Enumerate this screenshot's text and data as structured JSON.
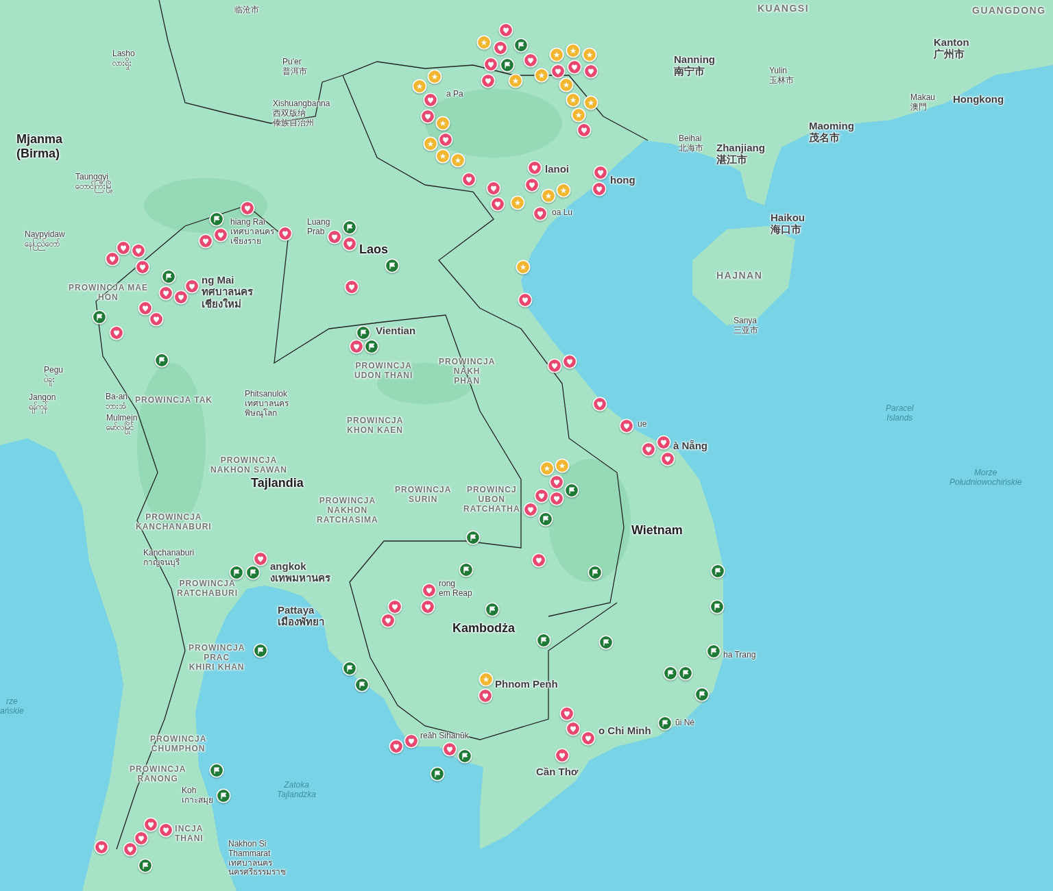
{
  "map": {
    "labels": [
      {
        "kind": "country",
        "lines": [
          "Mjanma",
          "(Birma)"
        ]
      },
      {
        "kind": "city",
        "lines": [
          "临沧市"
        ]
      },
      {
        "kind": "city",
        "lines": [
          "Lasho",
          "လားရှိုး"
        ]
      },
      {
        "kind": "city",
        "lines": [
          "Pu'er",
          "普洱市"
        ]
      },
      {
        "kind": "city",
        "lines": [
          "Xishuangbanna",
          "西双版纳",
          "傣族自治州"
        ]
      },
      {
        "kind": "city",
        "lines": [
          "Taunggyi",
          "တောင်ကြီးမြို့"
        ]
      },
      {
        "kind": "city",
        "lines": [
          "Naypyidaw",
          "နေပြည်တော်"
        ]
      },
      {
        "kind": "city",
        "lines": [
          "hiang Rai",
          "เทศบาลนคร",
          "เชียงราย"
        ]
      },
      {
        "kind": "city",
        "lines": [
          "Luang",
          "Prab"
        ]
      },
      {
        "kind": "country",
        "lines": [
          "Laos"
        ]
      },
      {
        "kind": "province",
        "lines": [
          "PROWINCJA MAE",
          "HON"
        ]
      },
      {
        "kind": "bigcity",
        "lines": [
          "ng Mai",
          "ทศบาลนคร",
          "เชียงใหม่"
        ]
      },
      {
        "kind": "bigcity",
        "lines": [
          "Vientian"
        ]
      },
      {
        "kind": "city",
        "lines": [
          "Pegu",
          "ပဲခူး"
        ]
      },
      {
        "kind": "province",
        "lines": [
          "PROWINCJA",
          "UDON THANI"
        ]
      },
      {
        "kind": "province",
        "lines": [
          "PROWINCJA",
          "NAKH",
          "PHAN"
        ]
      },
      {
        "kind": "city",
        "lines": [
          "Jangon",
          "ရန်ကုန်"
        ]
      },
      {
        "kind": "city",
        "lines": [
          "Ba-an",
          "ဘားအံ"
        ]
      },
      {
        "kind": "province",
        "lines": [
          "PROWINCJA TAK"
        ]
      },
      {
        "kind": "city",
        "lines": [
          "Phitsanulok",
          "เทศบาลนคร",
          "พิษณุโลก"
        ]
      },
      {
        "kind": "city",
        "lines": [
          "Mulmejn",
          "မော်လမြိုင်"
        ]
      },
      {
        "kind": "province",
        "lines": [
          "PROWINCJA",
          "KHON KAEN"
        ]
      },
      {
        "kind": "province",
        "lines": [
          "PROWINCJA",
          "NAKHON SAWAN"
        ]
      },
      {
        "kind": "country",
        "lines": [
          "Tajlandia"
        ]
      },
      {
        "kind": "province",
        "lines": [
          "PROWINCJA",
          "SURIN"
        ]
      },
      {
        "kind": "province",
        "lines": [
          "PROWINCJ",
          "UBON",
          "RATCHATHA"
        ]
      },
      {
        "kind": "province",
        "lines": [
          "PROWINCJA",
          "NAKHON",
          "RATCHASIMA"
        ]
      },
      {
        "kind": "province",
        "lines": [
          "PROWINCJA",
          "KANCHANABURI"
        ]
      },
      {
        "kind": "country",
        "lines": [
          "Wietnam"
        ]
      },
      {
        "kind": "city",
        "lines": [
          "Kanchanaburi",
          "กาญจนบุรี"
        ]
      },
      {
        "kind": "bigcity",
        "lines": [
          "angkok",
          "งเทพมหานคร"
        ]
      },
      {
        "kind": "province",
        "lines": [
          "PROWINCJA",
          "RATCHABURI"
        ]
      },
      {
        "kind": "city",
        "lines": [
          "rong",
          "em Reap"
        ]
      },
      {
        "kind": "bigcity",
        "lines": [
          "Pattaya",
          "เมืองพัทยา"
        ]
      },
      {
        "kind": "country",
        "lines": [
          "Kambodża"
        ]
      },
      {
        "kind": "province",
        "lines": [
          "PROWINCJA",
          "PRAC",
          "KHIRI KHAN"
        ]
      },
      {
        "kind": "city",
        "lines": [
          "ha Trang"
        ]
      },
      {
        "kind": "bigcity",
        "lines": [
          "Phnom Penh"
        ]
      },
      {
        "kind": "water",
        "lines": [
          "rze",
          "ańskie"
        ]
      },
      {
        "kind": "city",
        "lines": [
          "ũi Né"
        ]
      },
      {
        "kind": "bigcity",
        "lines": [
          "o Chi Minh"
        ]
      },
      {
        "kind": "city",
        "lines": [
          "reăh Sihanŭk"
        ]
      },
      {
        "kind": "province",
        "lines": [
          "PROWINCJA",
          "CHUMPHON"
        ]
      },
      {
        "kind": "province",
        "lines": [
          "PROWINCJA",
          "RANONG"
        ]
      },
      {
        "kind": "bigcity",
        "lines": [
          "Cần Thơ"
        ]
      },
      {
        "kind": "water",
        "lines": [
          "Zatoka",
          "Tajlandzka"
        ]
      },
      {
        "kind": "city",
        "lines": [
          "Koh",
          "เกาะสมุย"
        ]
      },
      {
        "kind": "province",
        "lines": [
          "INCJA",
          "THANI"
        ]
      },
      {
        "kind": "city",
        "lines": [
          "Nakhon Si",
          "Thammarat",
          "เทศบาลนคร",
          "นครศรีธรรมราช"
        ]
      },
      {
        "kind": "region",
        "lines": [
          "KUANGSI"
        ]
      },
      {
        "kind": "region",
        "lines": [
          "GUANGDONG"
        ]
      },
      {
        "kind": "bigcity",
        "lines": [
          "Kanton",
          "广州市"
        ]
      },
      {
        "kind": "bigcity",
        "lines": [
          "Nanning",
          "南宁市"
        ]
      },
      {
        "kind": "city",
        "lines": [
          "Yulin",
          "玉林市"
        ]
      },
      {
        "kind": "city",
        "lines": [
          "Makau",
          "澳門"
        ]
      },
      {
        "kind": "bigcity",
        "lines": [
          "Hongkong"
        ]
      },
      {
        "kind": "city",
        "lines": [
          "a Pa"
        ]
      },
      {
        "kind": "bigcity",
        "lines": [
          "Maoming",
          "茂名市"
        ]
      },
      {
        "kind": "city",
        "lines": [
          "Beihai",
          "北海市"
        ]
      },
      {
        "kind": "bigcity",
        "lines": [
          "Zhanjiang",
          "湛江市"
        ]
      },
      {
        "kind": "bigcity",
        "lines": [
          "lanoi"
        ]
      },
      {
        "kind": "bigcity",
        "lines": [
          "hong"
        ]
      },
      {
        "kind": "city",
        "lines": [
          "oa Lu"
        ]
      },
      {
        "kind": "bigcity",
        "lines": [
          "Haikou",
          "海口市"
        ]
      },
      {
        "kind": "region",
        "lines": [
          "HAJNAN"
        ]
      },
      {
        "kind": "city",
        "lines": [
          "Sanya",
          "三亚市"
        ]
      },
      {
        "kind": "water",
        "lines": [
          "Paracel",
          "Islands"
        ]
      },
      {
        "kind": "city",
        "lines": [
          "ue"
        ]
      },
      {
        "kind": "bigcity",
        "lines": [
          "à Nẵng"
        ]
      },
      {
        "kind": "water",
        "lines": [
          "Morze",
          "Południowochińskie"
        ]
      }
    ],
    "pins": [
      {
        "kind": "star"
      },
      {
        "kind": "heart"
      },
      {
        "kind": "flag"
      },
      {
        "kind": "heart"
      },
      {
        "kind": "heart"
      },
      {
        "kind": "heart"
      },
      {
        "kind": "flag"
      },
      {
        "kind": "star"
      },
      {
        "kind": "heart"
      },
      {
        "kind": "star"
      },
      {
        "kind": "star"
      },
      {
        "kind": "star"
      },
      {
        "kind": "star"
      },
      {
        "kind": "heart"
      },
      {
        "kind": "heart"
      },
      {
        "kind": "star"
      },
      {
        "kind": "heart"
      },
      {
        "kind": "star"
      },
      {
        "kind": "star"
      },
      {
        "kind": "star"
      },
      {
        "kind": "heart"
      },
      {
        "kind": "star"
      },
      {
        "kind": "star"
      },
      {
        "kind": "heart"
      },
      {
        "kind": "heart"
      },
      {
        "kind": "star"
      },
      {
        "kind": "heart"
      },
      {
        "kind": "star"
      },
      {
        "kind": "star"
      },
      {
        "kind": "star"
      },
      {
        "kind": "heart"
      },
      {
        "kind": "heart"
      },
      {
        "kind": "heart"
      },
      {
        "kind": "star"
      },
      {
        "kind": "heart"
      },
      {
        "kind": "heart"
      },
      {
        "kind": "star"
      },
      {
        "kind": "star"
      },
      {
        "kind": "heart"
      },
      {
        "kind": "heart"
      },
      {
        "kind": "heart"
      },
      {
        "kind": "star"
      },
      {
        "kind": "heart"
      },
      {
        "kind": "heart"
      },
      {
        "kind": "flag"
      },
      {
        "kind": "heart"
      },
      {
        "kind": "heart"
      },
      {
        "kind": "heart"
      },
      {
        "kind": "flag"
      },
      {
        "kind": "heart"
      },
      {
        "kind": "heart"
      },
      {
        "kind": "heart"
      },
      {
        "kind": "heart"
      },
      {
        "kind": "heart"
      },
      {
        "kind": "flag"
      },
      {
        "kind": "heart"
      },
      {
        "kind": "heart"
      },
      {
        "kind": "heart"
      },
      {
        "kind": "flag"
      },
      {
        "kind": "heart"
      },
      {
        "kind": "heart"
      },
      {
        "kind": "heart"
      },
      {
        "kind": "flag"
      },
      {
        "kind": "heart"
      },
      {
        "kind": "flag"
      },
      {
        "kind": "flag"
      },
      {
        "kind": "flag"
      },
      {
        "kind": "heart"
      },
      {
        "kind": "heart"
      },
      {
        "kind": "heart"
      },
      {
        "kind": "heart"
      },
      {
        "kind": "heart"
      },
      {
        "kind": "heart"
      },
      {
        "kind": "heart"
      },
      {
        "kind": "star"
      },
      {
        "kind": "star"
      },
      {
        "kind": "heart"
      },
      {
        "kind": "heart"
      },
      {
        "kind": "heart"
      },
      {
        "kind": "heart"
      },
      {
        "kind": "flag"
      },
      {
        "kind": "flag"
      },
      {
        "kind": "flag"
      },
      {
        "kind": "heart"
      },
      {
        "kind": "flag"
      },
      {
        "kind": "flag"
      },
      {
        "kind": "flag"
      },
      {
        "kind": "heart"
      },
      {
        "kind": "flag"
      },
      {
        "kind": "heart"
      },
      {
        "kind": "heart"
      },
      {
        "kind": "heart"
      },
      {
        "kind": "flag"
      },
      {
        "kind": "flag"
      },
      {
        "kind": "flag"
      },
      {
        "kind": "star"
      },
      {
        "kind": "heart"
      },
      {
        "kind": "heart"
      },
      {
        "kind": "heart"
      },
      {
        "kind": "heart"
      },
      {
        "kind": "heart"
      },
      {
        "kind": "heart"
      },
      {
        "kind": "heart"
      },
      {
        "kind": "heart"
      },
      {
        "kind": "flag"
      },
      {
        "kind": "flag"
      },
      {
        "kind": "flag"
      },
      {
        "kind": "flag"
      },
      {
        "kind": "flag"
      },
      {
        "kind": "flag"
      },
      {
        "kind": "flag"
      },
      {
        "kind": "flag"
      },
      {
        "kind": "flag"
      },
      {
        "kind": "flag"
      },
      {
        "kind": "flag"
      },
      {
        "kind": "flag"
      },
      {
        "kind": "flag"
      },
      {
        "kind": "heart"
      },
      {
        "kind": "heart"
      },
      {
        "kind": "heart"
      },
      {
        "kind": "heart"
      },
      {
        "kind": "heart"
      },
      {
        "kind": "heart"
      },
      {
        "kind": "flag"
      },
      {
        "kind": "heart"
      },
      {
        "kind": "heart"
      },
      {
        "kind": "flag"
      }
    ]
  }
}
